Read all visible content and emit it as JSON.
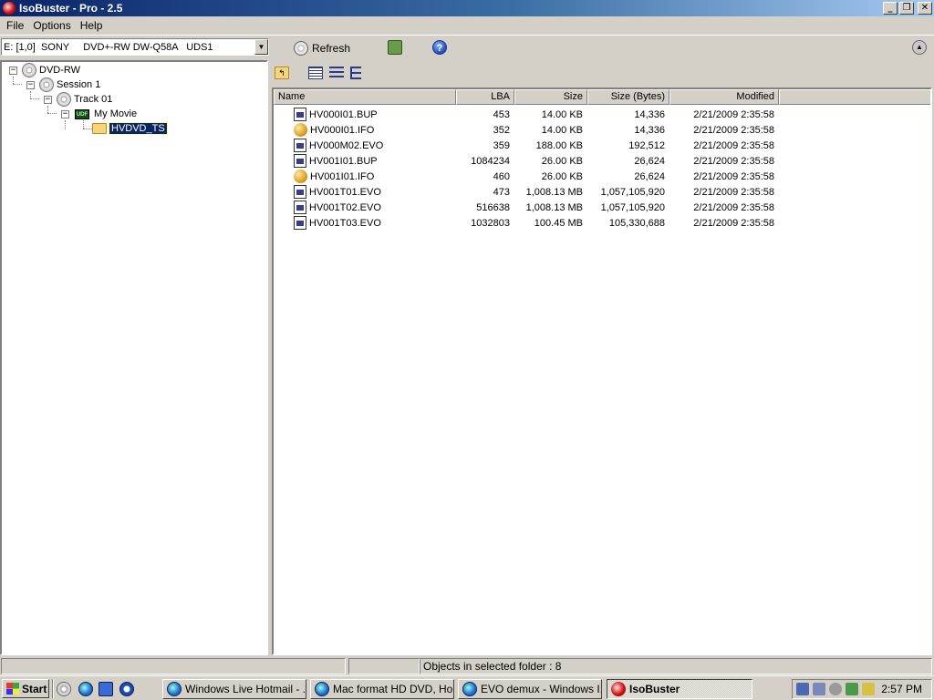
{
  "window": {
    "title": "IsoBuster - Pro - 2.5",
    "controls": {
      "minimize": "_",
      "maximize": "❐",
      "close": "✕"
    }
  },
  "menu": [
    "File",
    "Options",
    "Help"
  ],
  "toolbar": {
    "drive_value": "E: [1,0]  SONY     DVD+-RW DW-Q58A   UDS1",
    "drive_arrow": "▼",
    "refresh_label": "Refresh",
    "help_glyph": "?",
    "eject_glyph": "▲"
  },
  "tree": {
    "expand_glyph": "−",
    "items": [
      {
        "label": "DVD-RW",
        "icon": "disc-icon"
      },
      {
        "label": "Session 1",
        "icon": "disc-icon"
      },
      {
        "label": "Track 01",
        "icon": "disc-icon"
      },
      {
        "label": "My Movie",
        "icon": "udf-icon",
        "icon_text": "UDF"
      },
      {
        "label": "HVDVD_TS",
        "icon": "folder-icon",
        "selected": true
      }
    ]
  },
  "list": {
    "columns": [
      "Name",
      "LBA",
      "Size",
      "Size (Bytes)",
      "Modified"
    ],
    "rows": [
      {
        "name": "HV000I01.BUP",
        "icon": "doc-icon",
        "lba": "453",
        "size": "14.00 KB",
        "bytes": "14,336",
        "modified": "2/21/2009 2:35:58"
      },
      {
        "name": "HV000I01.IFO",
        "icon": "ifo-icon",
        "lba": "352",
        "size": "14.00 KB",
        "bytes": "14,336",
        "modified": "2/21/2009 2:35:58"
      },
      {
        "name": "HV000M02.EVO",
        "icon": "doc-icon",
        "lba": "359",
        "size": "188.00 KB",
        "bytes": "192,512",
        "modified": "2/21/2009 2:35:58"
      },
      {
        "name": "HV001I01.BUP",
        "icon": "doc-icon",
        "lba": "1084234",
        "size": "26.00 KB",
        "bytes": "26,624",
        "modified": "2/21/2009 2:35:58"
      },
      {
        "name": "HV001I01.IFO",
        "icon": "ifo-icon",
        "lba": "460",
        "size": "26.00 KB",
        "bytes": "26,624",
        "modified": "2/21/2009 2:35:58"
      },
      {
        "name": "HV001T01.EVO",
        "icon": "doc-icon",
        "lba": "473",
        "size": "1,008.13 MB",
        "bytes": "1,057,105,920",
        "modified": "2/21/2009 2:35:58"
      },
      {
        "name": "HV001T02.EVO",
        "icon": "doc-icon",
        "lba": "516638",
        "size": "1,008.13 MB",
        "bytes": "1,057,105,920",
        "modified": "2/21/2009 2:35:58"
      },
      {
        "name": "HV001T03.EVO",
        "icon": "doc-icon",
        "lba": "1032803",
        "size": "100.45 MB",
        "bytes": "105,330,688",
        "modified": "2/21/2009 2:35:58"
      }
    ]
  },
  "status": {
    "left": "",
    "middle": "",
    "objects": "Objects in selected folder : 8"
  },
  "taskbar": {
    "start_label": "Start",
    "tasks": [
      {
        "label": "Windows Live Hotmail - ...",
        "icon": "ie",
        "active": false
      },
      {
        "label": "Mac format HD DVD, Ho...",
        "icon": "ie",
        "active": false
      },
      {
        "label": "EVO demux - Windows I...",
        "icon": "ie",
        "active": false
      },
      {
        "label": "IsoBuster",
        "icon": "iso",
        "active": true
      }
    ],
    "clock": "2:57 PM"
  },
  "colors": {
    "titlebar_start": "#0a246a",
    "titlebar_end": "#a6caf0",
    "selection": "#0a246a",
    "chrome": "#d4d0c8"
  }
}
